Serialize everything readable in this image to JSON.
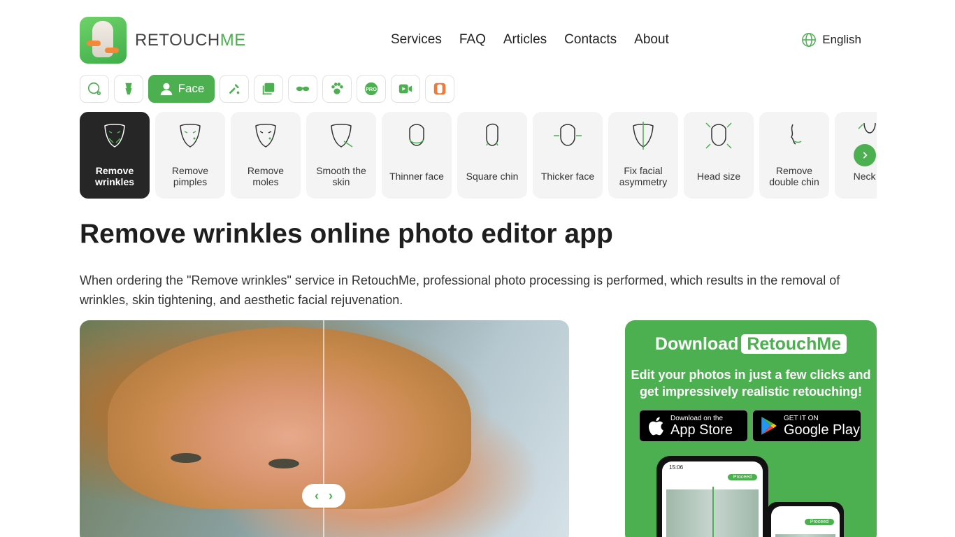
{
  "header": {
    "brand_prefix": "RETOUCH",
    "brand_suffix": "ME",
    "nav": [
      "Services",
      "FAQ",
      "Articles",
      "Contacts",
      "About"
    ],
    "language": "English"
  },
  "categories": {
    "active_label": "Face",
    "icons": [
      "magic-lasso-icon",
      "body-icon",
      "face-icon",
      "tools-icon",
      "photo-icon",
      "glasses-icon",
      "paw-icon",
      "pro-icon",
      "video-icon",
      "retouchme-app-icon"
    ]
  },
  "services": [
    {
      "label": "Remove wrinkles",
      "active": true
    },
    {
      "label": "Remove pimples"
    },
    {
      "label": "Remove moles"
    },
    {
      "label": "Smooth the skin"
    },
    {
      "label": "Thinner face"
    },
    {
      "label": "Square chin"
    },
    {
      "label": "Thicker face"
    },
    {
      "label": "Fix facial asymmetry"
    },
    {
      "label": "Head size"
    },
    {
      "label": "Remove double chin"
    },
    {
      "label": "Neck le"
    }
  ],
  "page": {
    "title": "Remove wrinkles online photo editor app",
    "description": "When ordering the \"Remove wrinkles\" service in RetouchMe, professional photo processing is performed, which results in the removal of wrinkles, skin tightening, and aesthetic facial rejuvenation."
  },
  "download": {
    "title": "Download",
    "brand": "RetouchMe",
    "subtitle": "Edit your photos in just a few clicks and get impressively realistic retouching!",
    "appstore_small": "Download on the",
    "appstore_big": "App Store",
    "googleplay_small": "GET IT ON",
    "googleplay_big": "Google Play",
    "phone_time": "15:06",
    "phone_button": "Proceed"
  },
  "colors": {
    "accent": "#4caf50",
    "active_tile": "#262626"
  }
}
